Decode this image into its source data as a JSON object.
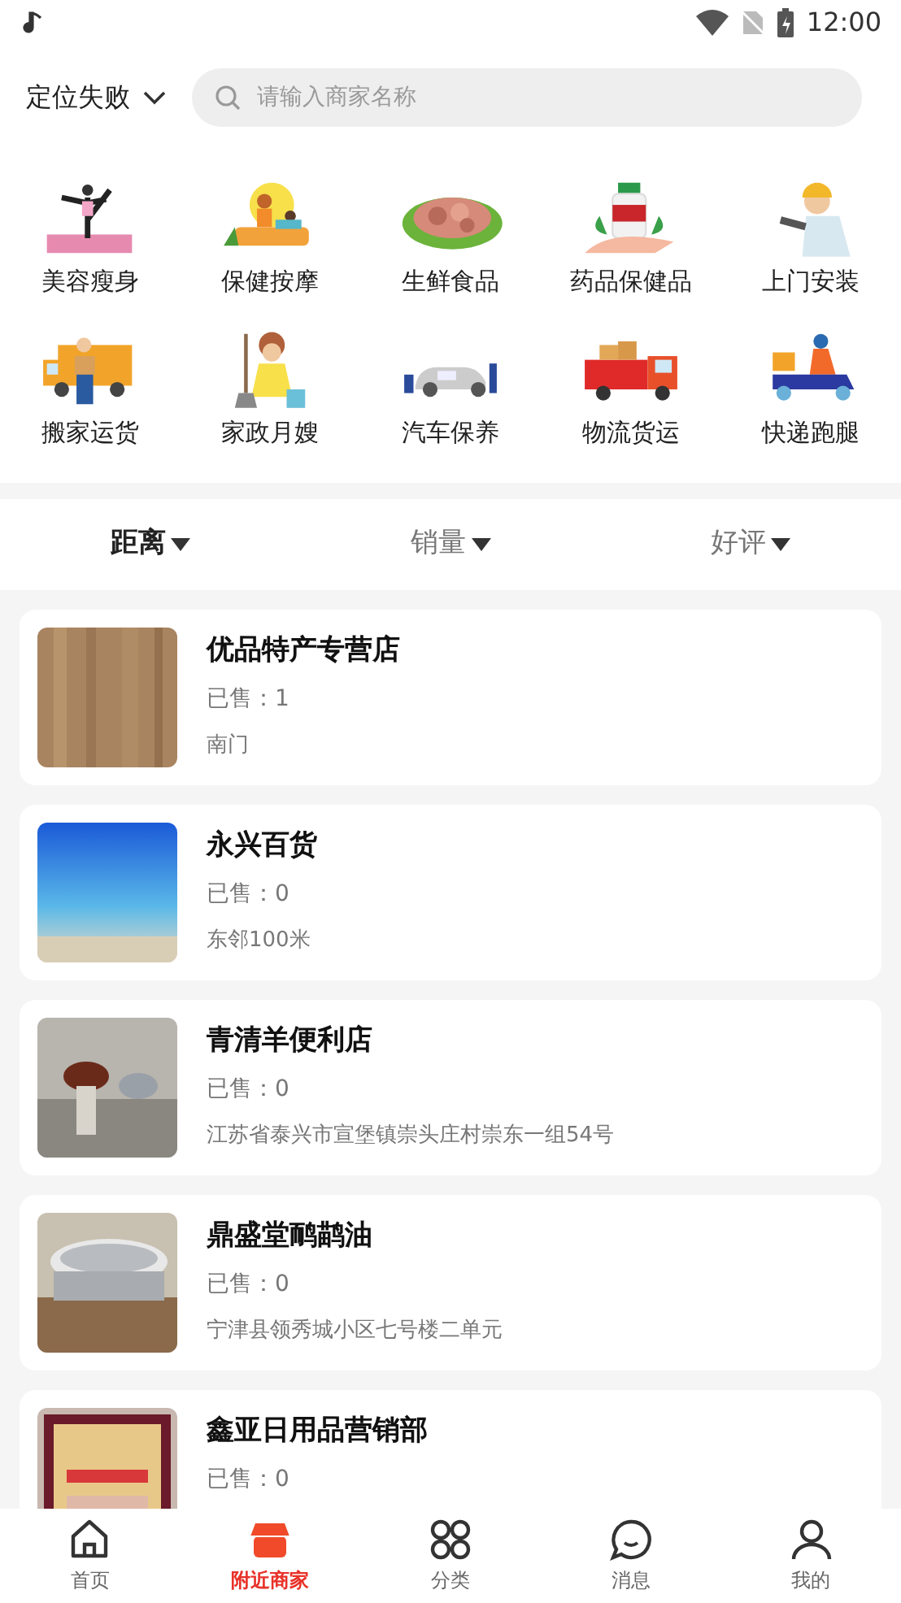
{
  "status_bar": {
    "time": "12:00"
  },
  "header": {
    "location": "定位失败",
    "search": {
      "placeholder": "请输入商家名称"
    }
  },
  "categories": [
    {
      "label": "美容瘦身"
    },
    {
      "label": "保健按摩"
    },
    {
      "label": "生鲜食品"
    },
    {
      "label": "药品保健品"
    },
    {
      "label": "上门安装"
    },
    {
      "label": "搬家运货"
    },
    {
      "label": "家政月嫂"
    },
    {
      "label": "汽车保养"
    },
    {
      "label": "物流货运"
    },
    {
      "label": "快递跑腿"
    }
  ],
  "sort_tabs": [
    {
      "label": "距离",
      "selected": true
    },
    {
      "label": "销量",
      "selected": false
    },
    {
      "label": "好评",
      "selected": false
    }
  ],
  "shops": [
    {
      "name": "优品特产专营店",
      "sold": "已售：1",
      "address": "南门"
    },
    {
      "name": "永兴百货",
      "sold": "已售：0",
      "address": "东邻100米"
    },
    {
      "name": "青清羊便利店",
      "sold": "已售：0",
      "address": "江苏省泰兴市宣堡镇崇头庄村崇东一组54号"
    },
    {
      "name": "鼎盛堂鸸鹋油",
      "sold": "已售：0",
      "address": "宁津县领秀城小区七号楼二单元"
    },
    {
      "name": "鑫亚日用品营销部",
      "sold": "已售：0"
    }
  ],
  "tab_bar": [
    {
      "label": "首页",
      "selected": false
    },
    {
      "label": "附近商家",
      "selected": true
    },
    {
      "label": "分类",
      "selected": false
    },
    {
      "label": "消息",
      "selected": false
    },
    {
      "label": "我的",
      "selected": false
    }
  ]
}
